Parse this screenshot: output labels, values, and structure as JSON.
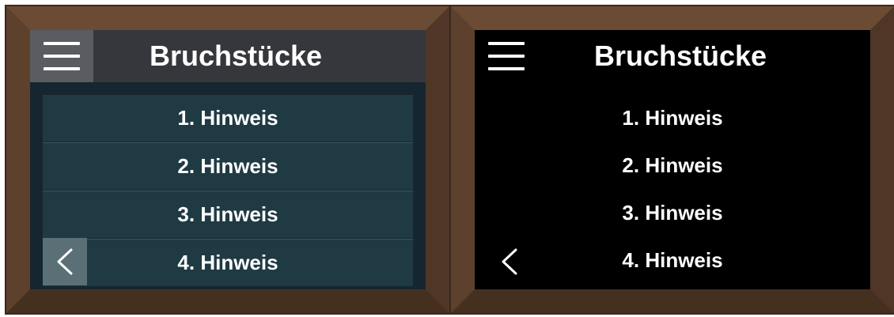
{
  "screens": [
    {
      "theme": "teal",
      "title": "Bruchstücke",
      "items": [
        "1. Hinweis",
        "2. Hinweis",
        "3. Hinweis",
        "4. Hinweis"
      ],
      "menu_icon": "hamburger-menu-icon",
      "back_icon": "chevron-left-icon"
    },
    {
      "theme": "dark",
      "title": "Bruchstücke",
      "items": [
        "1. Hinweis",
        "2. Hinweis",
        "3. Hinweis",
        "4. Hinweis"
      ],
      "menu_icon": "hamburger-menu-icon",
      "back_icon": "chevron-left-icon"
    }
  ],
  "colors": {
    "frame_wood": "#5a3f2c",
    "teal_background": "#152630",
    "teal_item": "#1f3a43",
    "teal_header": "#36373c",
    "dark_background": "#000000",
    "text": "#ffffff"
  }
}
